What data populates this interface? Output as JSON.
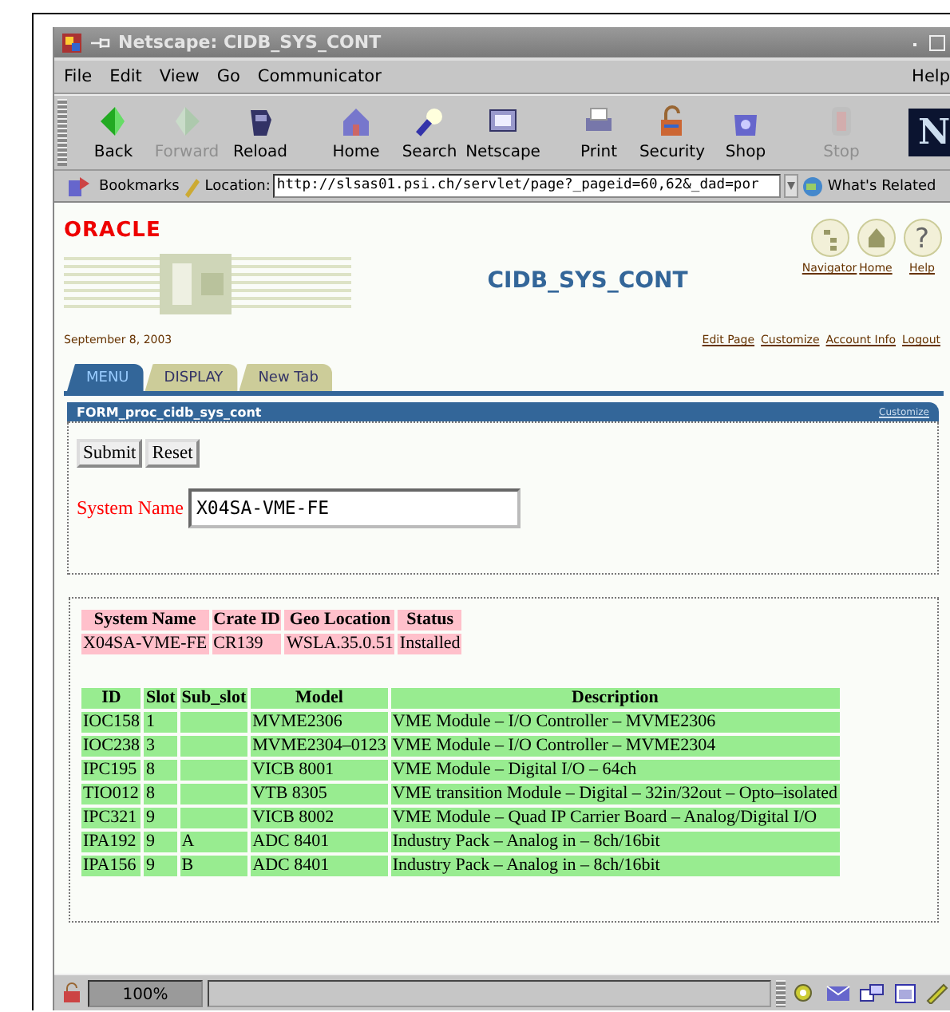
{
  "window": {
    "title": "Netscape: CIDB_SYS_CONT"
  },
  "menu": [
    "File",
    "Edit",
    "View",
    "Go",
    "Communicator",
    "Help"
  ],
  "toolbar": {
    "brand_mark": "N",
    "buttons": [
      {
        "label": "Back",
        "disabled": false
      },
      {
        "label": "Forward",
        "disabled": true
      },
      {
        "label": "Reload",
        "disabled": false
      },
      {
        "label": "Home",
        "disabled": false
      },
      {
        "label": "Search",
        "disabled": false
      },
      {
        "label": "Netscape",
        "disabled": false
      },
      {
        "label": "Print",
        "disabled": false
      },
      {
        "label": "Security",
        "disabled": false
      },
      {
        "label": "Shop",
        "disabled": false
      },
      {
        "label": "Stop",
        "disabled": true
      }
    ]
  },
  "location_bar": {
    "bookmarks": "Bookmarks",
    "label": "Location:",
    "url": "http://slsas01.psi.ch/servlet/page?_pageid=60,62&_dad=por",
    "related": "What's Related"
  },
  "page": {
    "logo": "ORACLE",
    "title": "CIDB_SYS_CONT",
    "help_glyph": "?",
    "nav_links": [
      "Navigator",
      "Home",
      "Help"
    ],
    "date": "September 8, 2003",
    "user_links": [
      "Edit Page",
      "Customize",
      "Account Info",
      "Logout"
    ]
  },
  "tabs": [
    {
      "label": "MENU",
      "selected": true
    },
    {
      "label": "DISPLAY",
      "selected": false
    },
    {
      "label": "New Tab",
      "selected": false
    }
  ],
  "portlet": {
    "title": "FORM_proc_cidb_sys_cont",
    "customize": "Customize",
    "buttons": [
      "Submit",
      "Reset"
    ],
    "field_label": "System Name",
    "field_value": "X04SA-VME-FE"
  },
  "system_table": {
    "columns": [
      "System Name",
      "Crate ID",
      "Geo Location",
      "Status"
    ],
    "rows": [
      [
        "X04SA-VME-FE",
        "CR139",
        "WSLA.35.0.51",
        "Installed"
      ]
    ]
  },
  "module_table": {
    "columns": [
      "ID",
      "Slot",
      "Sub_slot",
      "Model",
      "Description"
    ],
    "rows": [
      [
        "IOC158",
        "1",
        "",
        "MVME2306",
        "VME Module – I/O Controller – MVME2306"
      ],
      [
        "IOC238",
        "3",
        "",
        "MVME2304–0123",
        "VME Module – I/O Controller – MVME2304"
      ],
      [
        "IPC195",
        "8",
        "",
        "VICB 8001",
        "VME Module – Digital I/O – 64ch"
      ],
      [
        "TIO012",
        "8",
        "",
        "VTB 8305",
        "VME transition Module – Digital – 32in/32out – Opto–isolated"
      ],
      [
        "IPC321",
        "9",
        "",
        "VICB 8002",
        "VME Module – Quad IP Carrier Board – Analog/Digital I/O"
      ],
      [
        "IPA192",
        "9",
        "A",
        "ADC 8401",
        "Industry Pack – Analog in – 8ch/16bit"
      ],
      [
        "IPA156",
        "9",
        "B",
        "ADC 8401",
        "Industry Pack – Analog in – 8ch/16bit"
      ]
    ]
  },
  "status_bar": {
    "zoom": "100%"
  }
}
